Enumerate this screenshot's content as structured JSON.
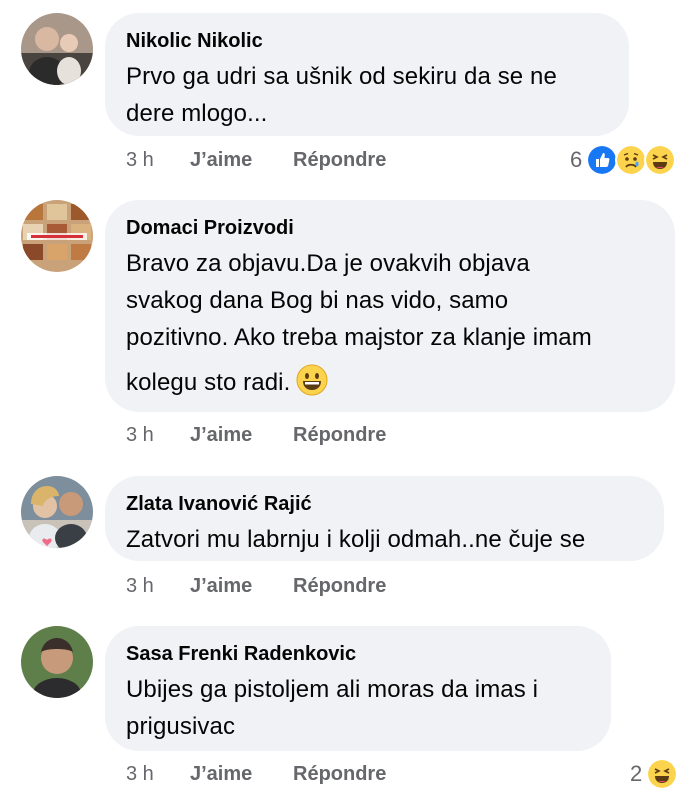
{
  "comments": [
    {
      "author": "Nikolic Nikolic",
      "text_lines": [
        "Prvo ga udri sa ušnik od sekiru da se ne",
        "dere mlogo..."
      ],
      "time": "3 h",
      "like_label": "J’aime",
      "reply_label": "Répondre",
      "reaction_count": "6",
      "reactions": [
        "like-icon",
        "sad-icon",
        "haha-icon"
      ]
    },
    {
      "author": "Domaci Proizvodi",
      "text_lines": [
        "Bravo za objavu.Da je ovakvih objava",
        "svakog dana Bog bi nas vido, samo",
        "pozitivno. Ako treba majstor za klanje imam",
        "kolegu sto radi."
      ],
      "inline_emoji": "grinning-face-icon",
      "time": "3 h",
      "like_label": "J’aime",
      "reply_label": "Répondre"
    },
    {
      "author": "Zlata Ivanović Rajić",
      "text_lines": [
        "Zatvori mu labrnju i kolji odmah..ne čuje se"
      ],
      "time": "3 h",
      "like_label": "J’aime",
      "reply_label": "Répondre"
    },
    {
      "author": "Sasa Frenki Radenkovic",
      "text_lines": [
        "Ubijes ga pistoljem ali moras da imas i",
        "prigusivac"
      ],
      "time": "3 h",
      "like_label": "J’aime",
      "reply_label": "Répondre",
      "reaction_count": "2",
      "reactions": [
        "haha-icon"
      ]
    }
  ],
  "colors": {
    "bubble": "#f0f2f5",
    "meta_text": "#65676b",
    "like_blue": "#1877f2",
    "emoji_yellow": "#fcd34d"
  }
}
